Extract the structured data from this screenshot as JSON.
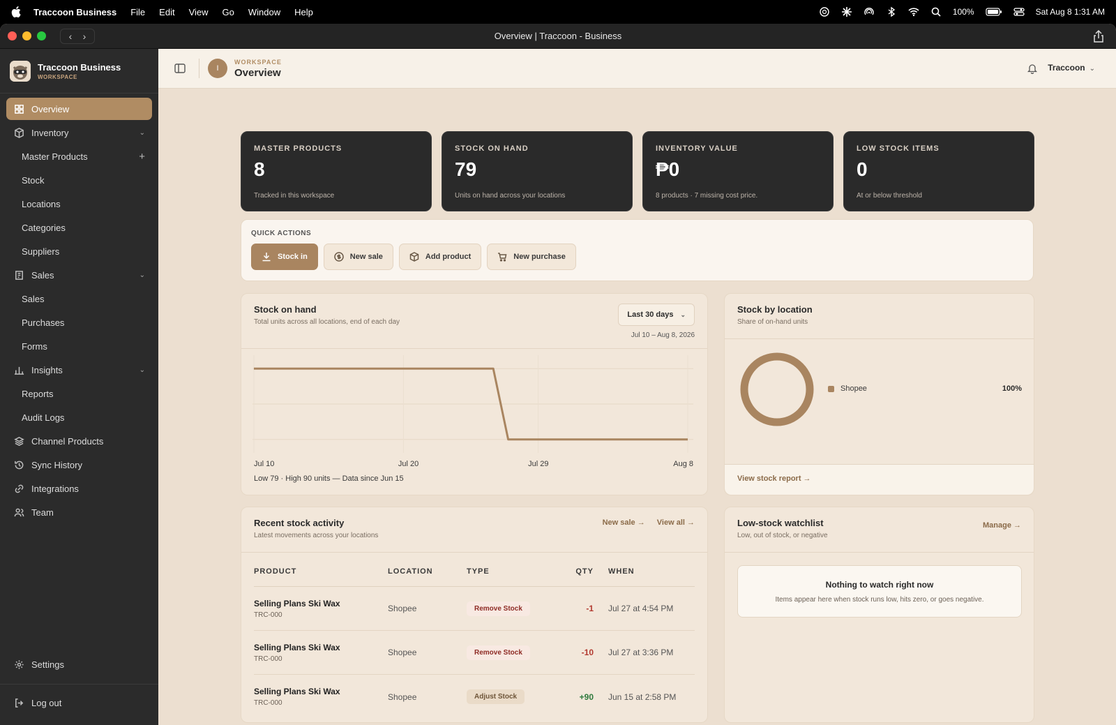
{
  "menubar": {
    "app": "Traccoon Business",
    "items": [
      "File",
      "Edit",
      "View",
      "Go",
      "Window",
      "Help"
    ],
    "battery": "100%",
    "datetime": "Sat Aug 8  1:31 AM"
  },
  "window": {
    "title": "Overview | Traccoon - Business"
  },
  "sidebar": {
    "brand_name": "Traccoon Business",
    "brand_sub": "WORKSPACE",
    "overview": "Overview",
    "inventory": "Inventory",
    "inventory_items": [
      "Master Products",
      "Stock",
      "Locations",
      "Categories",
      "Suppliers"
    ],
    "sales": "Sales",
    "sales_items": [
      "Sales",
      "Purchases",
      "Forms"
    ],
    "insights": "Insights",
    "insights_items": [
      "Reports",
      "Audit Logs"
    ],
    "channel_products": "Channel Products",
    "sync_history": "Sync History",
    "integrations": "Integrations",
    "team": "Team",
    "settings": "Settings",
    "logout": "Log out"
  },
  "topbar": {
    "avatar_initial": "I",
    "workspace_label": "WORKSPACE",
    "page_title": "Overview",
    "user": "Traccoon"
  },
  "stats": [
    {
      "label": "MASTER PRODUCTS",
      "value": "8",
      "desc": "Tracked in this workspace"
    },
    {
      "label": "STOCK ON HAND",
      "value": "79",
      "desc": "Units on hand across your locations"
    },
    {
      "label": "INVENTORY VALUE",
      "value": "₱0",
      "desc": "8 products · 7 missing cost price."
    },
    {
      "label": "LOW STOCK ITEMS",
      "value": "0",
      "desc": "At or below threshold"
    }
  ],
  "quick_actions": {
    "title": "QUICK ACTIONS",
    "stock_in": "Stock in",
    "new_sale": "New sale",
    "add_product": "Add product",
    "new_purchase": "New purchase"
  },
  "stock_chart": {
    "title": "Stock on hand",
    "subtitle": "Total units across all locations, end of each day",
    "range": "Last 30 days",
    "range_dates": "Jul 10 – Aug 8, 2026",
    "note": "Low 79 · High 90 units — Data since Jun 15"
  },
  "chart_data": {
    "type": "line",
    "x": [
      "Jul 10",
      "Jul 26",
      "Jul 27",
      "Aug 8"
    ],
    "y": [
      90,
      90,
      79,
      79
    ],
    "x_ticks": [
      "Jul 10",
      "Jul 20",
      "Jul 29",
      "Aug 8"
    ],
    "x_tick_days": [
      0,
      10,
      19,
      29
    ],
    "x_days": [
      0,
      16,
      17,
      29
    ],
    "ylim": [
      78,
      91
    ],
    "grid": true,
    "color": "#a98560"
  },
  "stock_location": {
    "title": "Stock by location",
    "subtitle": "Share of on-hand units",
    "legend_name": "Shopee",
    "legend_pct": "100%",
    "link": "View stock report →",
    "color": "#a98560"
  },
  "activity": {
    "title": "Recent stock activity",
    "subtitle": "Latest movements across your locations",
    "new_sale_link": "New sale →",
    "view_all_link": "View all →",
    "headers": {
      "product": "PRODUCT",
      "location": "LOCATION",
      "type": "TYPE",
      "qty": "QTY",
      "when": "WHEN"
    },
    "rows": [
      {
        "product": "Selling Plans Ski Wax",
        "sku": "TRC-000",
        "location": "Shopee",
        "type": "Remove Stock",
        "qty": "-1",
        "when": "Jul 27 at 4:54 PM"
      },
      {
        "product": "Selling Plans Ski Wax",
        "sku": "TRC-000",
        "location": "Shopee",
        "type": "Remove Stock",
        "qty": "-10",
        "when": "Jul 27 at 3:36 PM"
      },
      {
        "product": "Selling Plans Ski Wax",
        "sku": "TRC-000",
        "location": "Shopee",
        "type": "Adjust Stock",
        "qty": "+90",
        "when": "Jun 15 at 2:58 PM"
      }
    ]
  },
  "watchlist": {
    "title": "Low-stock watchlist",
    "subtitle": "Low, out of stock, or negative",
    "manage": "Manage →",
    "empty_title": "Nothing to watch right now",
    "empty_sub": "Items appear here when stock runs low, hits zero, or goes negative."
  }
}
